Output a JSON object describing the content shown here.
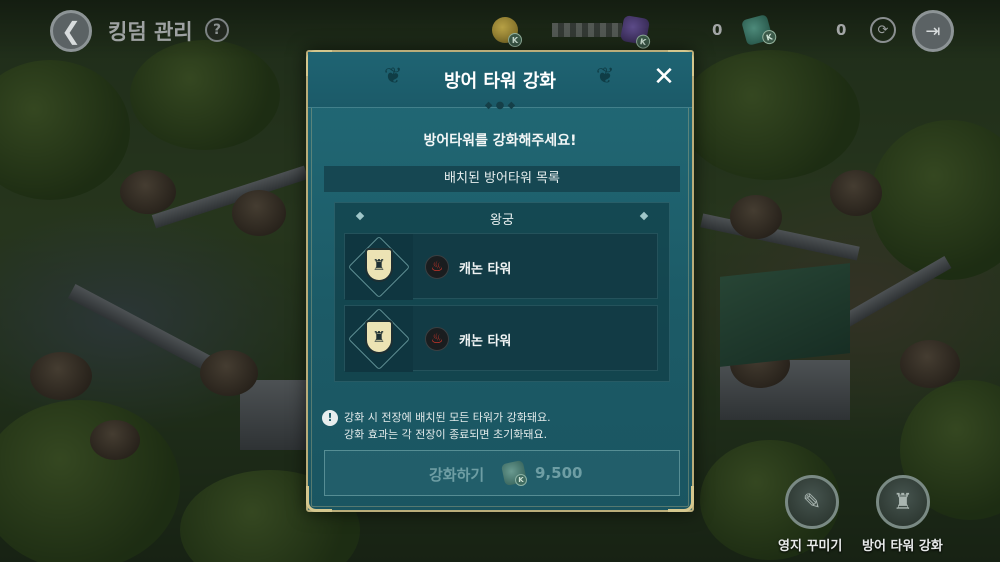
{
  "topbar": {
    "back_icon": "back-arrow-icon",
    "title": "킹덤 관리",
    "help_label": "?",
    "currencies": [
      {
        "name": "gold",
        "icon": "gold-coin-icon",
        "value": ""
      },
      {
        "name": "purple_gem",
        "icon": "purple-gem-icon",
        "value": "0"
      },
      {
        "name": "green_gem",
        "icon": "green-gem-icon",
        "value": "0"
      }
    ],
    "currency_badge": "K",
    "exit_icon": "exit-door-icon"
  },
  "modal": {
    "title": "방어 타워 강화",
    "close_label": "✕",
    "subtitle": "방어타워를 강화해주세요!",
    "list_header": "배치된 방어타워 목록",
    "group_label": "왕궁",
    "towers": [
      {
        "name": "캐논 타워",
        "element_icon": "fire-icon"
      },
      {
        "name": "캐논 타워",
        "element_icon": "fire-icon"
      }
    ],
    "notice_lines": [
      "강화 시 전장에 배치된 모든 타워가 강화돼요.",
      "강화 효과는 각 전장이 종료되면 초기화돼요."
    ],
    "upgrade_button": {
      "label": "강화하기",
      "cost": "9,500",
      "currency_badge": "K"
    }
  },
  "bottom_buttons": [
    {
      "label": "영지 꾸미기",
      "icon": "decorate-icon"
    },
    {
      "label": "방어 타워 강화",
      "icon": "tower-upgrade-icon"
    }
  ],
  "colors": {
    "modal_bg": "#1c5b67",
    "modal_border": "#b9ad7a",
    "fire": "#e43a2d"
  }
}
